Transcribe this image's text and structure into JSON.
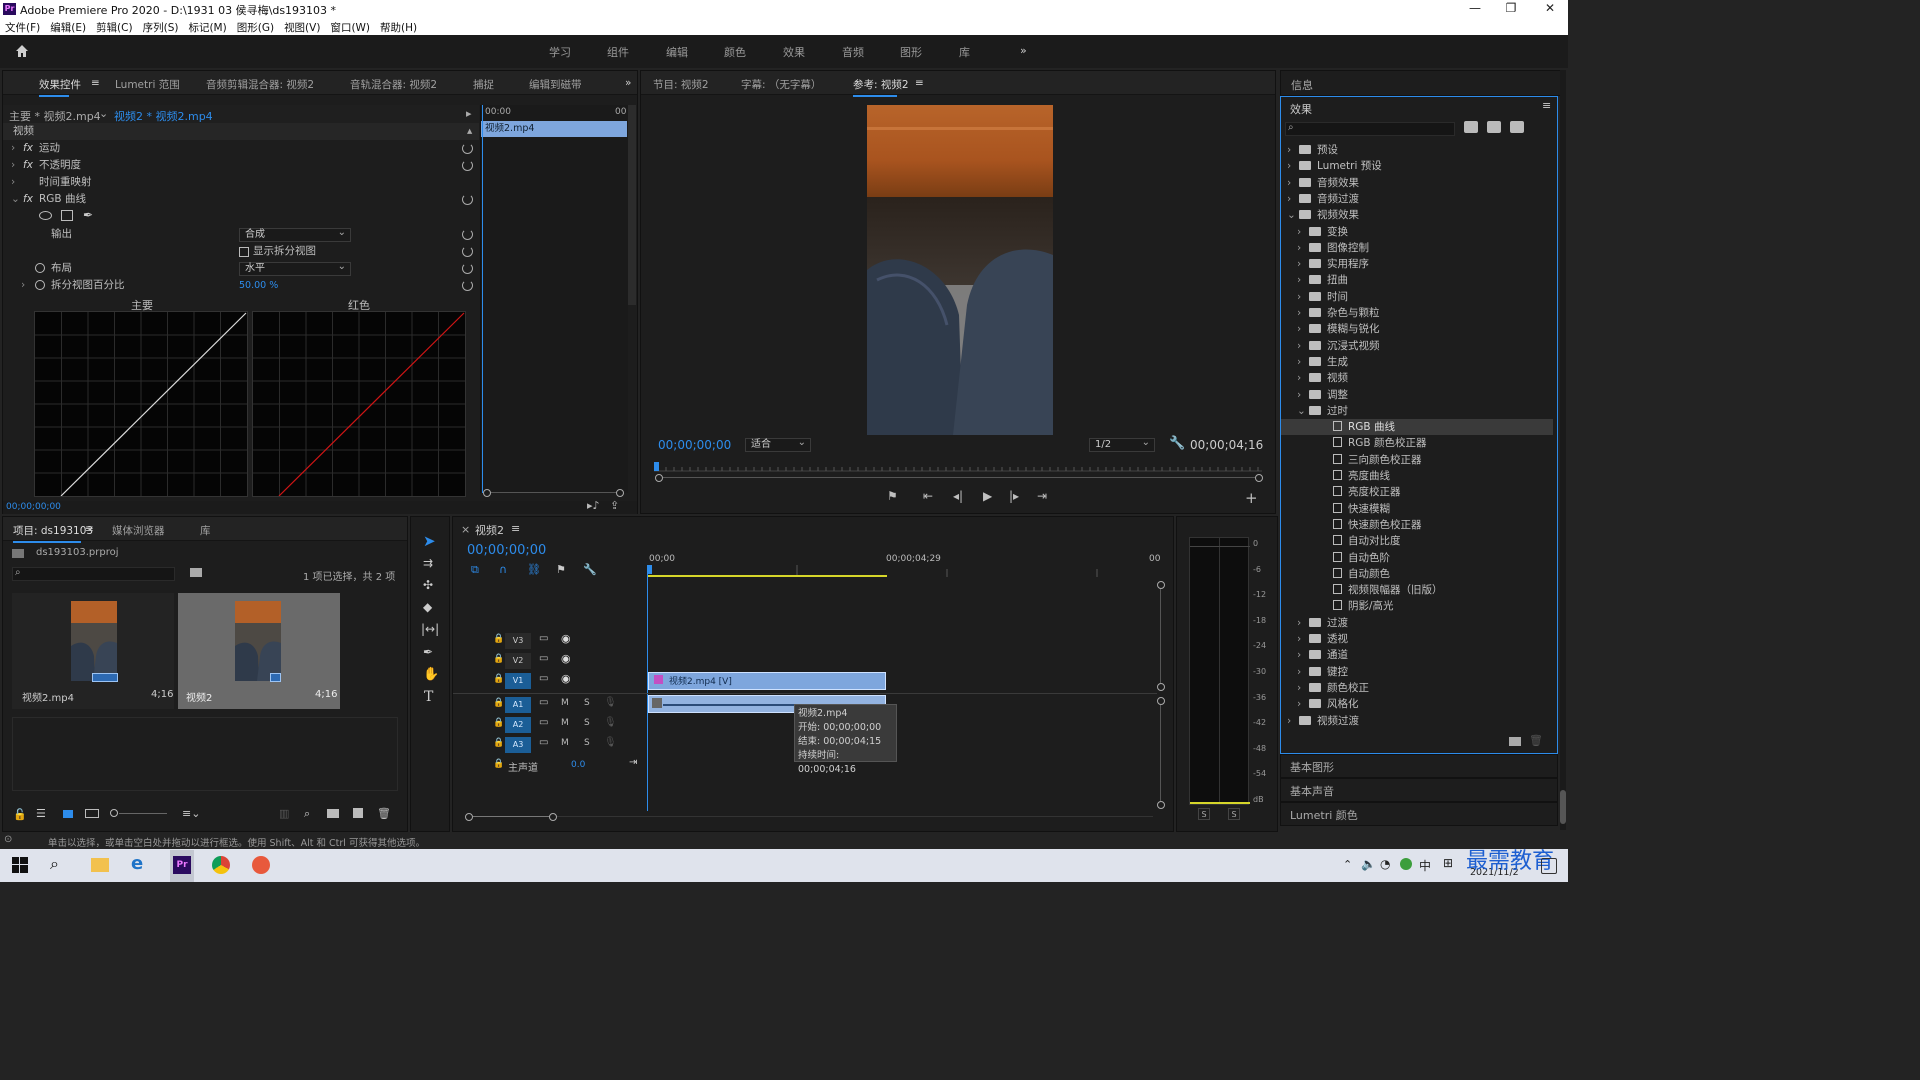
{
  "app": {
    "title": "Adobe Premiere Pro 2020 - D:\\1931 03 侯寻梅\\ds193103 *",
    "icon": "Pr"
  },
  "menu": [
    "文件(F)",
    "编辑(E)",
    "剪辑(C)",
    "序列(S)",
    "标记(M)",
    "图形(G)",
    "视图(V)",
    "窗口(W)",
    "帮助(H)"
  ],
  "workspaces": [
    "学习",
    "组件",
    "编辑",
    "颜色",
    "效果",
    "音频",
    "图形",
    "库"
  ],
  "effect_panel": {
    "tabs": [
      "效果控件",
      "Lumetri 范围",
      "音频剪辑混合器: 视频2",
      "音轨混合器: 视频2",
      "捕捉",
      "编辑到磁带"
    ],
    "source_master": "主要 * 视频2.mp4",
    "source_clip": "视频2 * 视频2.mp4",
    "section_video": "视频",
    "fx_items": [
      "运动",
      "不透明度",
      "时间重映射",
      "RGB 曲线"
    ],
    "output_label": "输出",
    "output_value": "合成",
    "split_view_label": "显示拆分视图",
    "layout_label": "布局",
    "layout_value": "水平",
    "split_pct_label": "拆分视图百分比",
    "split_pct_value": "50.00 %",
    "curve_main": "主要",
    "curve_red": "红色",
    "mini_tl_start": "00:00",
    "mini_tl_end": "00",
    "mini_clip": "视频2.mp4",
    "timecode": "00;00;00;00"
  },
  "program_panel": {
    "tabs": [
      "节目: 视频2",
      "字幕: （无字幕）",
      "参考: 视频2"
    ],
    "timecode": "00;00;00;00",
    "fit": "适合",
    "resolution": "1/2",
    "duration": "00;00;04;16"
  },
  "info_panel": {
    "title": "信息"
  },
  "effects_panel": {
    "title": "效果",
    "tree": [
      {
        "label": "预设",
        "level": 0,
        "type": "folder"
      },
      {
        "label": "Lumetri 预设",
        "level": 0,
        "type": "folder"
      },
      {
        "label": "音频效果",
        "level": 0,
        "type": "folder"
      },
      {
        "label": "音频过渡",
        "level": 0,
        "type": "folder"
      },
      {
        "label": "视频效果",
        "level": 0,
        "type": "folder",
        "open": true
      },
      {
        "label": "变换",
        "level": 1,
        "type": "folder"
      },
      {
        "label": "图像控制",
        "level": 1,
        "type": "folder"
      },
      {
        "label": "实用程序",
        "level": 1,
        "type": "folder"
      },
      {
        "label": "扭曲",
        "level": 1,
        "type": "folder"
      },
      {
        "label": "时间",
        "level": 1,
        "type": "folder"
      },
      {
        "label": "杂色与颗粒",
        "level": 1,
        "type": "folder"
      },
      {
        "label": "模糊与锐化",
        "level": 1,
        "type": "folder"
      },
      {
        "label": "沉浸式视频",
        "level": 1,
        "type": "folder"
      },
      {
        "label": "生成",
        "level": 1,
        "type": "folder"
      },
      {
        "label": "视频",
        "level": 1,
        "type": "folder"
      },
      {
        "label": "调整",
        "level": 1,
        "type": "folder"
      },
      {
        "label": "过时",
        "level": 1,
        "type": "folder",
        "open": true
      },
      {
        "label": "RGB 曲线",
        "level": 2,
        "type": "effect",
        "selected": true
      },
      {
        "label": "RGB 颜色校正器",
        "level": 2,
        "type": "effect"
      },
      {
        "label": "三向颜色校正器",
        "level": 2,
        "type": "effect"
      },
      {
        "label": "亮度曲线",
        "level": 2,
        "type": "effect"
      },
      {
        "label": "亮度校正器",
        "level": 2,
        "type": "effect"
      },
      {
        "label": "快速模糊",
        "level": 2,
        "type": "effect"
      },
      {
        "label": "快速颜色校正器",
        "level": 2,
        "type": "effect"
      },
      {
        "label": "自动对比度",
        "level": 2,
        "type": "effect"
      },
      {
        "label": "自动色阶",
        "level": 2,
        "type": "effect"
      },
      {
        "label": "自动颜色",
        "level": 2,
        "type": "effect"
      },
      {
        "label": "视频限幅器（旧版）",
        "level": 2,
        "type": "effect"
      },
      {
        "label": "阴影/高光",
        "level": 2,
        "type": "effect"
      },
      {
        "label": "过渡",
        "level": 1,
        "type": "folder"
      },
      {
        "label": "透视",
        "level": 1,
        "type": "folder"
      },
      {
        "label": "通道",
        "level": 1,
        "type": "folder"
      },
      {
        "label": "键控",
        "level": 1,
        "type": "folder"
      },
      {
        "label": "颜色校正",
        "level": 1,
        "type": "folder"
      },
      {
        "label": "风格化",
        "level": 1,
        "type": "folder"
      },
      {
        "label": "视频过渡",
        "level": 0,
        "type": "folder"
      }
    ],
    "sub_panels": [
      "基本图形",
      "基本声音",
      "Lumetri 颜色"
    ]
  },
  "project_panel": {
    "tabs": [
      "项目: ds193103",
      "媒体浏览器",
      "库"
    ],
    "file": "ds193103.prproj",
    "selection_info": "1 项已选择，共 2 项",
    "items": [
      {
        "name": "视频2.mp4",
        "duration": "4;16"
      },
      {
        "name": "视频2",
        "duration": "4;16"
      }
    ]
  },
  "timeline": {
    "tab": "视频2",
    "timecode": "00;00;00;00",
    "ruler": [
      "00;00",
      "00;00;04;29",
      "00"
    ],
    "tracks_v": [
      "V3",
      "V2",
      "V1"
    ],
    "tracks_a": [
      "A1",
      "A2",
      "A3"
    ],
    "master": "主声道",
    "master_value": "0.0",
    "clip_v": "视频2.mp4 [V]",
    "tooltip": {
      "name": "视频2.mp4",
      "start": "开始: 00;00;00;00",
      "end": "结束: 00;00;04;15",
      "duration": "持续时间: 00;00;04;16"
    }
  },
  "meter": {
    "scale": [
      "0",
      "-6",
      "-12",
      "-18",
      "-24",
      "-30",
      "-36",
      "-42",
      "-48",
      "-54",
      "dB"
    ],
    "solo": [
      "S",
      "S"
    ]
  },
  "status": "单击以选择，或单击空白处并拖动以进行框选。使用 Shift、Alt 和 Ctrl 可获得其他选项。",
  "taskbar": {
    "ime": "中",
    "date": "2021/11/2",
    "watermark": "最需教育"
  },
  "colors": {
    "accent": "#2d8ceb",
    "clip_video": "#7a9fd8",
    "clip_audio": "#9ab5e0",
    "track_on": "#1b5e97"
  }
}
